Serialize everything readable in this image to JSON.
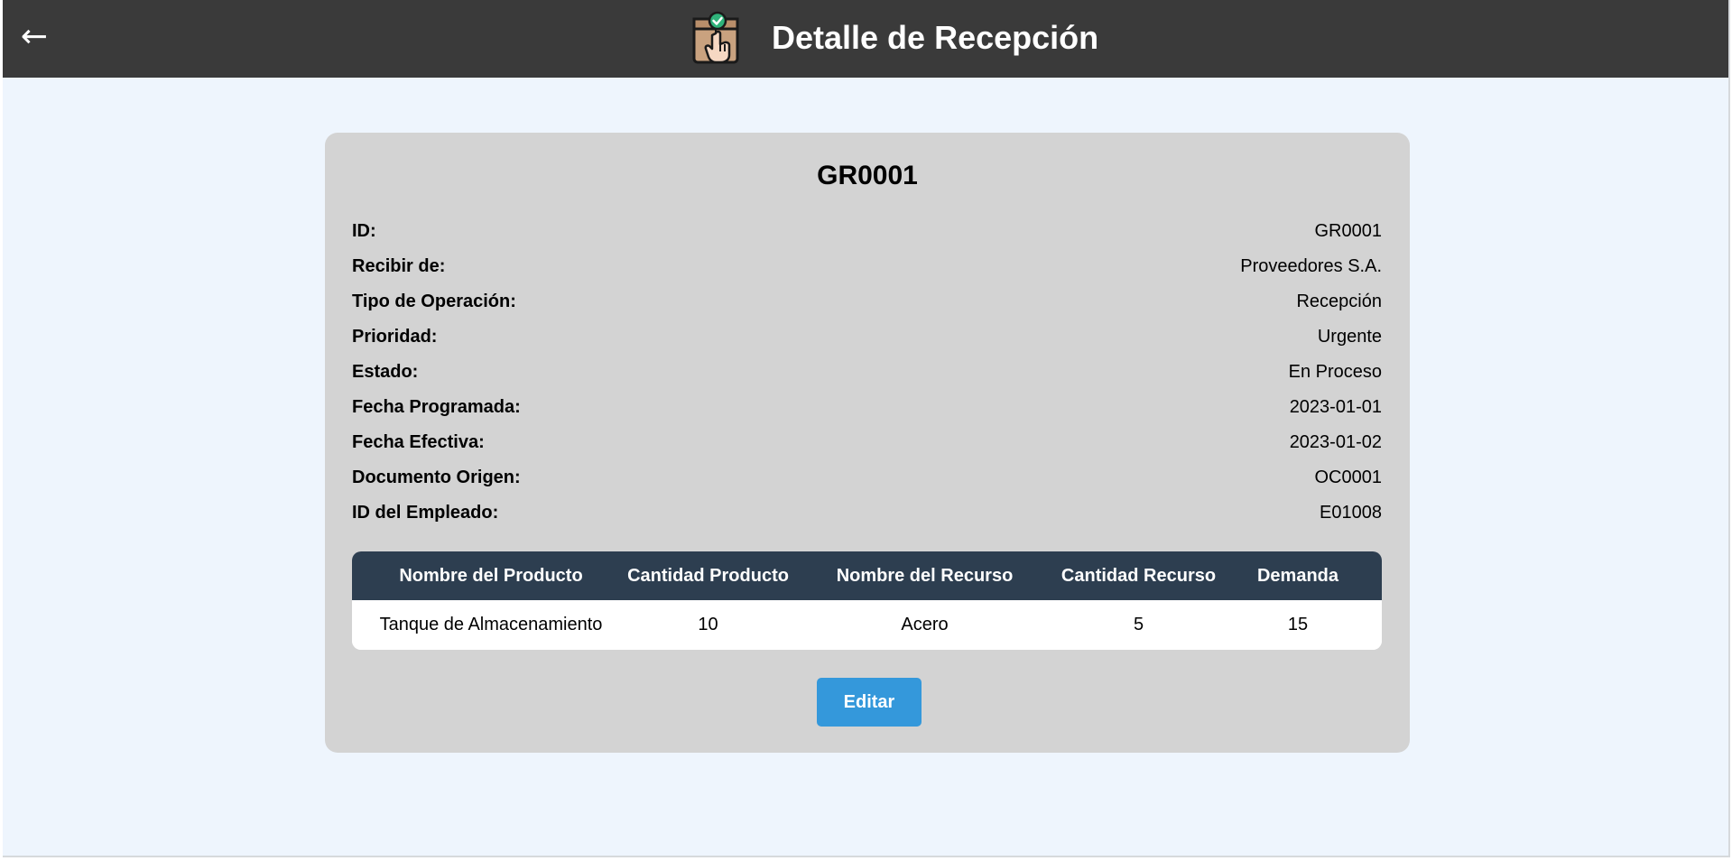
{
  "header": {
    "back_icon": "←",
    "logo_icon": "package-check-hand-icon",
    "title": "Detalle de Recepción"
  },
  "card": {
    "title": "GR0001",
    "fields": [
      {
        "label": "ID:",
        "value": "GR0001"
      },
      {
        "label": "Recibir de:",
        "value": "Proveedores S.A."
      },
      {
        "label": "Tipo de Operación:",
        "value": "Recepción"
      },
      {
        "label": "Prioridad:",
        "value": "Urgente"
      },
      {
        "label": "Estado:",
        "value": "En Proceso"
      },
      {
        "label": "Fecha Programada:",
        "value": "2023-01-01"
      },
      {
        "label": "Fecha Efectiva:",
        "value": "2023-01-02"
      },
      {
        "label": "Documento Origen:",
        "value": "OC0001"
      },
      {
        "label": "ID del Empleado:",
        "value": "E01008"
      }
    ],
    "table": {
      "headers": [
        "Nombre del Producto",
        "Cantidad Producto",
        "Nombre del Recurso",
        "Cantidad Recurso",
        "Demanda"
      ],
      "rows": [
        [
          "Tanque de Almacenamiento",
          "10",
          "Acero",
          "5",
          "15"
        ]
      ]
    },
    "edit_label": "Editar"
  },
  "colors": {
    "header_bg": "#3a3a3a",
    "page_bg": "#eef5fd",
    "card_bg": "#d3d3d3",
    "table_header_bg": "#2d3e50",
    "button_bg": "#3498db"
  }
}
